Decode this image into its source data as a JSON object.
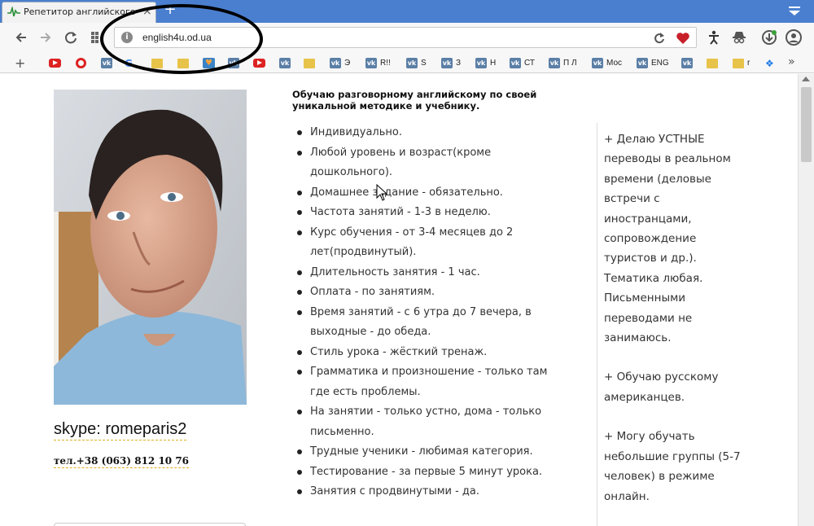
{
  "browser": {
    "tab_title": "Репетитор английского в О",
    "tab_close": "×",
    "new_tab": "+",
    "address": "english4u.od.ua",
    "site_info": "i"
  },
  "bookmarks": [
    {
      "type": "add",
      "label": "+"
    },
    {
      "type": "youtube",
      "label": ""
    },
    {
      "type": "opera",
      "label": ""
    },
    {
      "type": "vk",
      "label": ""
    },
    {
      "type": "google",
      "label": ""
    },
    {
      "type": "folder",
      "label": ""
    },
    {
      "type": "folder",
      "label": ""
    },
    {
      "type": "heart",
      "label": ""
    },
    {
      "type": "vk",
      "label": ""
    },
    {
      "type": "youtube",
      "label": ""
    },
    {
      "type": "vk",
      "label": ""
    },
    {
      "type": "folder",
      "label": ""
    },
    {
      "type": "vk",
      "label": "Э"
    },
    {
      "type": "vk",
      "label": "R!!"
    },
    {
      "type": "vk",
      "label": "S"
    },
    {
      "type": "vk",
      "label": "З"
    },
    {
      "type": "vk",
      "label": "Н"
    },
    {
      "type": "vk",
      "label": "СТ"
    },
    {
      "type": "vk",
      "label": "П Л"
    },
    {
      "type": "vk",
      "label": "Мос"
    },
    {
      "type": "vk",
      "label": "ENG"
    },
    {
      "type": "vk",
      "label": ""
    },
    {
      "type": "folder",
      "label": ""
    },
    {
      "type": "folder",
      "label": "r"
    },
    {
      "type": "dropbox",
      "label": ""
    },
    {
      "type": "more",
      "label": "»"
    }
  ],
  "profile": {
    "skype": "skype: romeparis2",
    "phone": "тел.+38 (063) 812 10 76"
  },
  "intro": "Обучаю разговорному английскому по своей уникальной методике и учебнику.",
  "features": [
    "Индивидуально.",
    "Любой уровень и возраст(кроме дошкольного).",
    "Домашнее задание - обязательно.",
    "Частота занятий - 1-3 в неделю.",
    "Курс обучения - от 3-4 месяцев до 2 лет(продвинутый).",
    "Длительность занятия - 1 час.",
    "Оплата - по занятиям.",
    "Время занятий - с 6 утра до 7 вечера, в выходные - до обеда.",
    "Стиль урока - жёсткий тренаж.",
    "Грамматика и произношение - только там где есть проблемы.",
    "На занятии - только устно, дома - только письменно.",
    "Трудные ученики - любимая категория.",
    "Тестирование - за первые 5 минут урока.",
    "Занятия с продвинутыми - да."
  ],
  "services": [
    "+ Делаю УСТНЫЕ переводы в реальном времени (деловые встречи с иностранцами, сопровождение туристов и др.). Тематика любая. Письменными переводами не занимаюсь.",
    "+ Обучаю русскому американцев.",
    "+ Могу обучать небольшие группы (5-7 человек) в режиме онлайн."
  ]
}
